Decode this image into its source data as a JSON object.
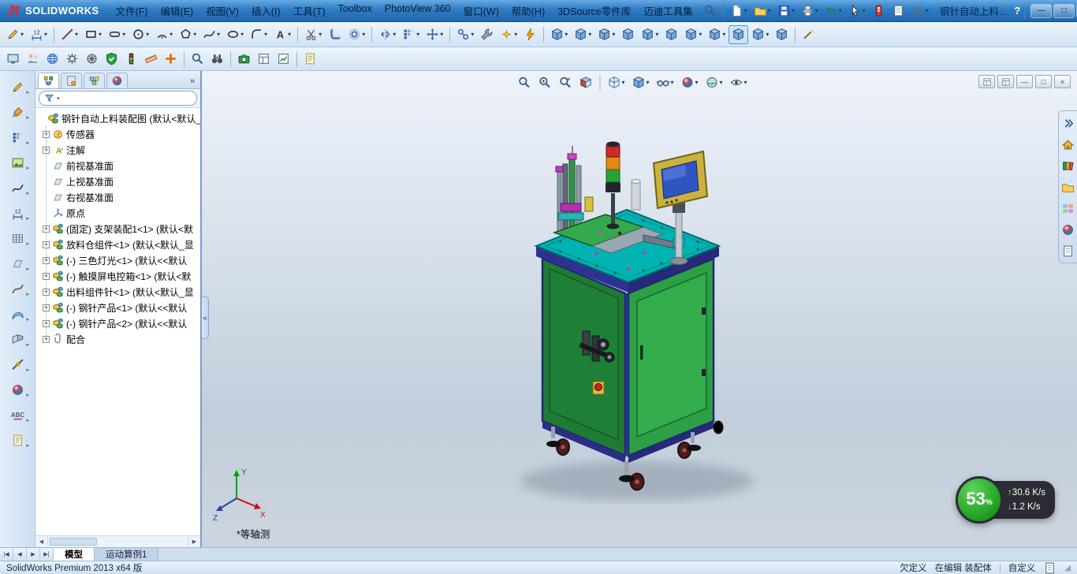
{
  "titlebar": {
    "logo_text": "SOLIDWORKS",
    "doc_title": "钢针自动上料...",
    "help_label": "?",
    "menus": [
      "文件(F)",
      "编辑(E)",
      "视图(V)",
      "插入(I)",
      "工具(T)",
      "Toolbox",
      "PhotoView 360",
      "窗口(W)",
      "帮助(H)",
      "3DSource零件库",
      "迈迪工具集"
    ],
    "quick_tools": [
      {
        "name": "search",
        "icon": "magnifier"
      },
      {
        "sep": true
      },
      {
        "name": "new-document",
        "icon": "doc",
        "dd": true
      },
      {
        "name": "open-document",
        "icon": "folder",
        "dd": true
      },
      {
        "name": "save",
        "icon": "disk",
        "dd": true
      },
      {
        "name": "print",
        "icon": "printer",
        "dd": true
      },
      {
        "name": "undo",
        "icon": "undo",
        "dd": true
      },
      {
        "name": "select",
        "icon": "cursor",
        "dd": true
      },
      {
        "name": "rebuild",
        "icon": "rebuild"
      },
      {
        "name": "file-properties",
        "icon": "sheet"
      },
      {
        "name": "options",
        "icon": "gear",
        "dd": true
      }
    ],
    "window_controls": [
      {
        "name": "minimize",
        "glyph": "—"
      },
      {
        "name": "maximize",
        "glyph": "□"
      },
      {
        "name": "close",
        "glyph": "×"
      }
    ]
  },
  "toolbars": {
    "sketch": [
      {
        "name": "sketch",
        "icon": "pencil",
        "dd": true
      },
      {
        "name": "smart-dimension",
        "icon": "dimension",
        "dd": true
      },
      {
        "sep": true
      },
      {
        "name": "line",
        "icon": "line",
        "dd": true
      },
      {
        "name": "corner-rectangle",
        "icon": "rect",
        "dd": true
      },
      {
        "name": "straight-slot",
        "icon": "slot",
        "dd": true
      },
      {
        "name": "circle",
        "icon": "circle",
        "dd": true
      },
      {
        "name": "centerpoint-arc",
        "icon": "arc",
        "dd": true
      },
      {
        "name": "polygon",
        "icon": "polygon",
        "dd": true
      },
      {
        "name": "spline",
        "icon": "spline",
        "dd": true
      },
      {
        "name": "ellipse",
        "icon": "ellipse",
        "dd": true
      },
      {
        "name": "sketch-fillet",
        "icon": "fillet",
        "dd": true
      },
      {
        "name": "sketch-text",
        "icon": "text",
        "dd": true
      },
      {
        "sep": true
      },
      {
        "name": "trim-entities",
        "icon": "scissors",
        "dd": true
      },
      {
        "name": "convert-entities",
        "icon": "convert"
      },
      {
        "name": "offset-entities",
        "icon": "offset",
        "dd": true
      },
      {
        "sep": true
      },
      {
        "name": "mirror-entities",
        "icon": "mirror",
        "dd": true
      },
      {
        "name": "linear-sketch-pattern",
        "icon": "pattern",
        "dd": true
      },
      {
        "name": "move-entities",
        "icon": "move",
        "dd": true
      },
      {
        "sep": true
      },
      {
        "name": "display-delete-relations",
        "icon": "relations",
        "dd": true
      },
      {
        "name": "repair-sketch",
        "icon": "wrench"
      },
      {
        "name": "quick-snaps",
        "icon": "snap",
        "dd": true
      },
      {
        "name": "rapid-sketch",
        "icon": "flash"
      },
      {
        "sep": true
      },
      {
        "name": "insert-components",
        "icon": "cube",
        "dd": true
      },
      {
        "name": "mate",
        "icon": "cube",
        "dd": true
      },
      {
        "name": "linear-component-pattern",
        "icon": "cube",
        "dd": true
      },
      {
        "name": "smart-fasteners",
        "icon": "cube"
      },
      {
        "name": "move-component",
        "icon": "cube",
        "dd": true
      },
      {
        "name": "show-hidden-components",
        "icon": "cube"
      },
      {
        "name": "assembly-features",
        "icon": "cube",
        "dd": true
      },
      {
        "name": "reference-geometry",
        "icon": "cube",
        "dd": true
      },
      {
        "name": "new-motion-study",
        "icon": "cube",
        "active": true
      },
      {
        "name": "bill-of-materials",
        "icon": "cube",
        "dd": true
      },
      {
        "name": "exploded-view",
        "icon": "cube"
      },
      {
        "sep": true
      },
      {
        "name": "instant3d",
        "icon": "wand"
      }
    ],
    "standard": [
      {
        "name": "full-screen-preview",
        "icon": "screen"
      },
      {
        "name": "publish-edrawings",
        "icon": "people"
      },
      {
        "name": "3d-content-central",
        "icon": "globe"
      },
      {
        "name": "options",
        "icon": "gear"
      },
      {
        "name": "motion-manager",
        "icon": "wheel"
      },
      {
        "name": "toolbox",
        "icon": "shield"
      },
      {
        "name": "simulation-advisor",
        "icon": "traffic"
      },
      {
        "name": "measure",
        "icon": "ruler"
      },
      {
        "name": "mass-properties",
        "icon": "plus"
      },
      {
        "sep": true
      },
      {
        "name": "selection-search",
        "icon": "magnifier"
      },
      {
        "name": "find-references",
        "icon": "binocular"
      },
      {
        "sep": true
      },
      {
        "name": "screen-capture",
        "icon": "camera"
      },
      {
        "name": "print-preview",
        "icon": "layout"
      },
      {
        "name": "performance-evaluation",
        "icon": "chart"
      },
      {
        "sep": true
      },
      {
        "name": "design-binder",
        "icon": "note"
      }
    ],
    "left_strip": [
      {
        "name": "sketch-tools-flyout",
        "icon": "pencil"
      },
      {
        "name": "annotation-tools-flyout",
        "icon": "brush"
      },
      {
        "name": "blocks-flyout",
        "icon": "pattern"
      },
      {
        "name": "sketch-picture",
        "icon": "photo"
      },
      {
        "name": "spline-tools-flyout",
        "icon": "spline"
      },
      {
        "name": "dimension-tools-flyout",
        "icon": "dimension"
      },
      {
        "name": "table-tools-flyout",
        "icon": "grid"
      },
      {
        "name": "reference-geometry-flyout",
        "icon": "plane"
      },
      {
        "name": "curve-tools-flyout",
        "icon": "curve"
      },
      {
        "name": "surface-tools-flyout",
        "icon": "surface"
      },
      {
        "name": "sheet-metal-flyout",
        "icon": "fold"
      },
      {
        "name": "weldment-flyout",
        "icon": "weld"
      },
      {
        "name": "appearance-flyout",
        "icon": "ball"
      },
      {
        "name": "spell-checker",
        "icon": "abc"
      },
      {
        "name": "design-journal",
        "icon": "note"
      }
    ]
  },
  "feature_panel": {
    "tabs": [
      {
        "name": "featuremanager-tab",
        "icon": "tree",
        "active": true
      },
      {
        "name": "propertymanager-tab",
        "icon": "property",
        "active": false
      },
      {
        "name": "configurationmanager-tab",
        "icon": "config",
        "active": false
      },
      {
        "name": "displaymanager-tab",
        "icon": "ball",
        "active": false
      }
    ],
    "overflow_label": "»",
    "filter_placeholder": "",
    "tree": [
      {
        "icon": "assembly",
        "label": "钢针自动上料装配图 (默认<默认_",
        "root": true
      },
      {
        "icon": "sensor",
        "label": "传感器",
        "expand": true
      },
      {
        "icon": "annotation",
        "label": "注解",
        "expand": true
      },
      {
        "icon": "plane",
        "label": "前视基准面"
      },
      {
        "icon": "plane",
        "label": "上视基准面"
      },
      {
        "icon": "plane",
        "label": "右视基准面"
      },
      {
        "icon": "origin",
        "label": "原点"
      },
      {
        "icon": "assembly",
        "label": "(固定) 支架装配1<1> (默认<默",
        "expand": true
      },
      {
        "icon": "assembly",
        "label": "放料仓组件<1> (默认<默认_显",
        "expand": true
      },
      {
        "icon": "assembly",
        "label": "(-) 三色灯光<1> (默认<<默认",
        "expand": true
      },
      {
        "icon": "assembly",
        "label": "(-) 触摸屏电控箱<1> (默认<默",
        "expand": true
      },
      {
        "icon": "assembly",
        "label": "出料组件针<1> (默认<默认_显",
        "expand": true
      },
      {
        "icon": "assembly",
        "label": "(-) 钢针产品<1> (默认<<默认",
        "expand": true
      },
      {
        "icon": "assembly",
        "label": "(-) 钢针产品<2> (默认<<默认",
        "expand": true
      },
      {
        "icon": "mates",
        "label": "配合",
        "expand": true
      }
    ]
  },
  "viewport": {
    "view_label": "*等轴测",
    "collapse_handle": "«",
    "triad": {
      "x": "X",
      "y": "Y",
      "z": "Z"
    },
    "hud": [
      {
        "name": "zoom-to-fit",
        "icon": "magnifier"
      },
      {
        "name": "zoom-to-area",
        "icon": "magplus"
      },
      {
        "name": "previous-view",
        "icon": "magarrow"
      },
      {
        "name": "section-view",
        "icon": "section"
      },
      {
        "sep": true
      },
      {
        "name": "view-orientation",
        "icon": "wirecube",
        "dd": true
      },
      {
        "name": "display-style",
        "icon": "cube",
        "dd": true
      },
      {
        "name": "hide-show-items",
        "icon": "glasses",
        "dd": true
      },
      {
        "name": "edit-appearance",
        "icon": "ball",
        "dd": true
      },
      {
        "name": "apply-scene",
        "icon": "scene",
        "dd": true
      },
      {
        "name": "view-settings",
        "icon": "eye",
        "dd": true
      }
    ],
    "doc_controls": [
      {
        "name": "viewport-split-horizontal",
        "icon": "layout"
      },
      {
        "name": "viewport-split-vertical",
        "icon": "layout"
      },
      {
        "name": "doc-minimize",
        "glyph": "—"
      },
      {
        "name": "doc-restore",
        "glyph": "□"
      },
      {
        "name": "doc-close",
        "glyph": "×"
      }
    ],
    "task_pane": [
      {
        "name": "taskpane-collapse",
        "icon": "chev"
      },
      {
        "name": "solidworks-resources",
        "icon": "home"
      },
      {
        "name": "design-library",
        "icon": "library"
      },
      {
        "name": "file-explorer",
        "icon": "folder"
      },
      {
        "name": "view-palette",
        "icon": "palette"
      },
      {
        "name": "appearances-scenes",
        "icon": "ball"
      },
      {
        "name": "custom-properties",
        "icon": "sheet"
      }
    ]
  },
  "doc_tabs": {
    "nav": [
      "|◀",
      "◀",
      "▶",
      "▶|"
    ],
    "tabs": [
      {
        "label": "模型",
        "active": true
      },
      {
        "label": "运动算例1",
        "active": false
      }
    ]
  },
  "statusbar": {
    "app_version": "SolidWorks Premium 2013 x64 版",
    "define_status": "欠定义",
    "edit_status": "在编辑 装配体",
    "custom_label": "自定义"
  },
  "net_monitor": {
    "percent": "53",
    "unit": "%",
    "up_arrow": "↑",
    "up_value": "30.6 K/s",
    "down_arrow": "↓",
    "down_value": "1.2 K/s"
  }
}
